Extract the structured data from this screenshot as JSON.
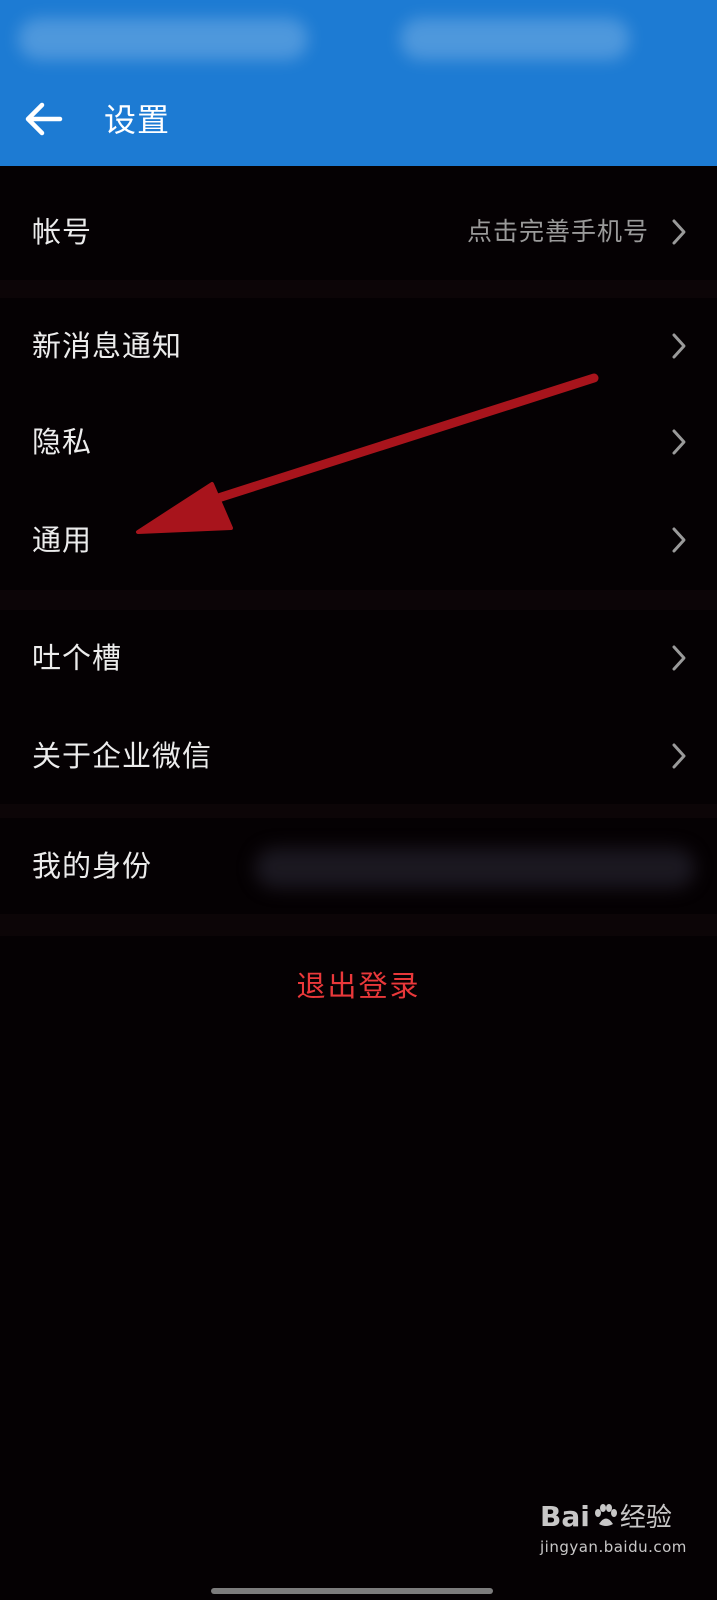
{
  "header": {
    "title": "设置",
    "back_icon": "arrow-left-icon",
    "background_color": "#1d7bd3"
  },
  "settings": {
    "account": {
      "label": "帐号",
      "value": "点击完善手机号"
    },
    "notifications": {
      "label": "新消息通知"
    },
    "privacy": {
      "label": "隐私"
    },
    "general": {
      "label": "通用"
    },
    "feedback": {
      "label": "吐个槽"
    },
    "about": {
      "label": "关于企业微信"
    },
    "identity": {
      "label": "我的身份"
    }
  },
  "logout": {
    "label": "退出登录",
    "color": "#e9383a"
  },
  "annotation": {
    "type": "arrow",
    "color": "#a8141c",
    "points_to": "general"
  },
  "watermark": {
    "logo_text_a": "Bai",
    "logo_text_b": "经验",
    "url": "jingyan.baidu.com"
  },
  "icons": {
    "chevron": "chevron-right-icon"
  }
}
